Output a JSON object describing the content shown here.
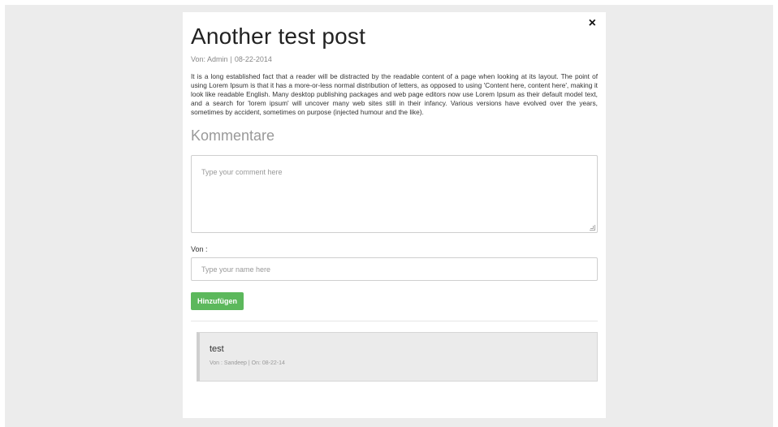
{
  "post": {
    "title": "Another test post",
    "meta": {
      "author_prefix": "Von: Admin",
      "separator": "|",
      "date": "08-22-2014"
    },
    "body": "It is a long established fact that a reader will be distracted by the readable content of a page when looking at its layout. The point of using Lorem Ipsum is that it has a more-or-less normal distribution of letters, as opposed to using 'Content here, content here', making it look like readable English. Many desktop publishing packages and web page editors now use Lorem Ipsum as their default model text, and a search for 'lorem ipsum' will uncover many web sites still in their infancy. Various versions have evolved over the years, sometimes by accident, sometimes on purpose (injected humour and the like)."
  },
  "modal": {
    "close_glyph": "×"
  },
  "comments_section": {
    "heading": "Kommentare",
    "comment_placeholder": "Type your comment here",
    "name_label": "Von :",
    "name_placeholder": "Type your name here",
    "submit_label": "Hinzufügen",
    "items": [
      {
        "text": "test",
        "meta": "Von : Sandeep | On: 08-22-14"
      }
    ]
  },
  "colors": {
    "backdrop": "#ececec",
    "accent_button": "#5cb85c",
    "comment_bg": "#ebebeb"
  },
  "icons": {
    "close": "close-icon",
    "resize": "resize-grip-icon"
  }
}
